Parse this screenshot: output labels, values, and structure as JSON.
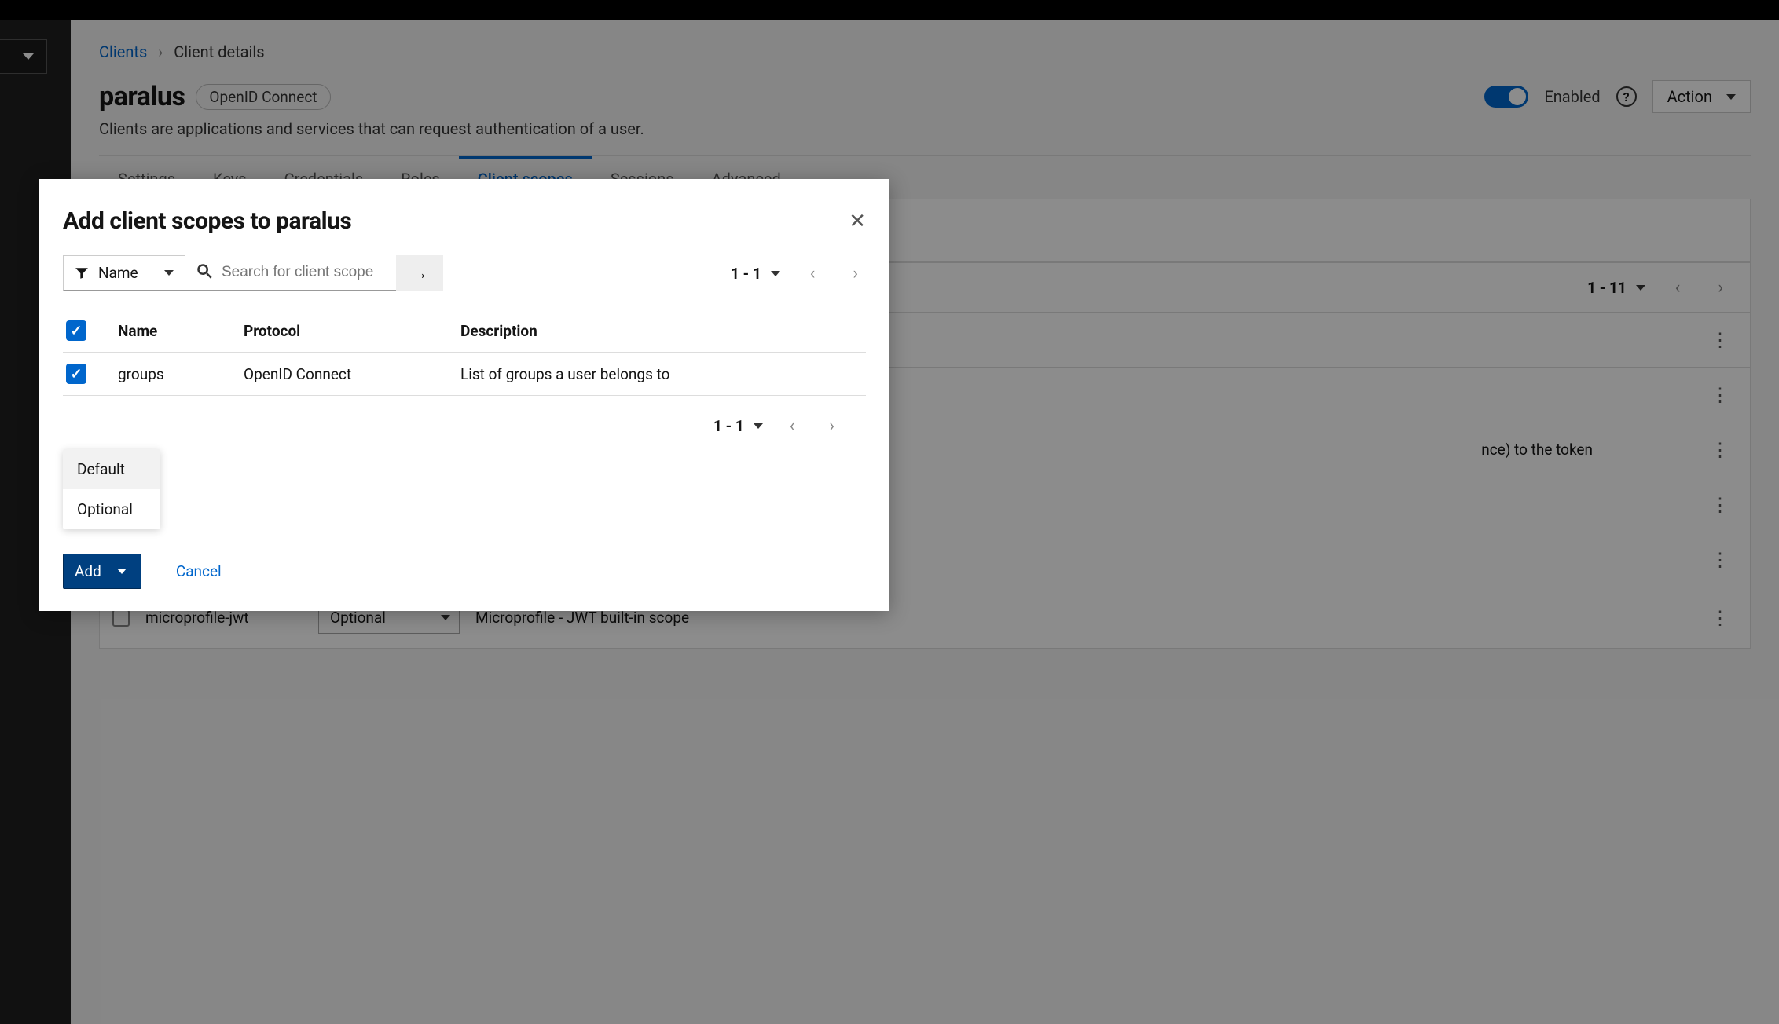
{
  "breadcrumb": {
    "root": "Clients",
    "current": "Client details"
  },
  "page": {
    "title": "paralus",
    "badge": "OpenID Connect",
    "enabled_label": "Enabled",
    "action_label": "Action",
    "subtitle": "Clients are applications and services that can request authentication of a user."
  },
  "tabs": [
    "Settings",
    "Keys",
    "Credentials",
    "Roles",
    "Client scopes",
    "Sessions",
    "Advanced"
  ],
  "bg_pager": {
    "range": "1 - 11"
  },
  "bg_rows": [
    {
      "name": "microprofile-jwt",
      "assigned": "Optional",
      "desc": "Microprofile - JWT built-in scope"
    }
  ],
  "bg_row_partial_desc": "nce) to the token",
  "modal": {
    "title": "Add client scopes to paralus",
    "filter_label": "Name",
    "search_placeholder": "Search for client scope",
    "pager_range": "1 - 1",
    "columns": {
      "name": "Name",
      "protocol": "Protocol",
      "description": "Description"
    },
    "rows": [
      {
        "name": "groups",
        "protocol": "OpenID Connect",
        "description": "List of groups a user belongs to"
      }
    ],
    "add_options": [
      "Default",
      "Optional"
    ],
    "add_label": "Add",
    "cancel_label": "Cancel"
  }
}
